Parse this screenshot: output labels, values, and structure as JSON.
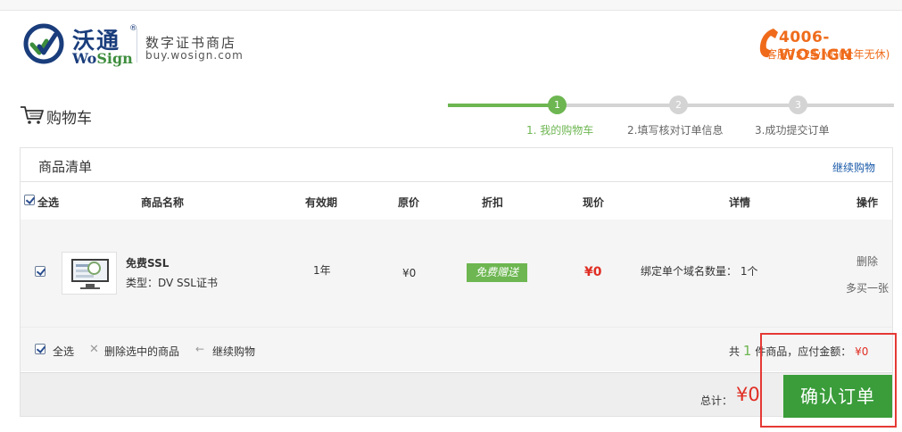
{
  "brand": {
    "name_cn": "沃通",
    "registered_mark": "®",
    "name_en_a": "Wo",
    "name_en_b": "Sign",
    "store_name": "数字证书商店",
    "store_url": "buy.wosign.com",
    "hotline": "4006-WOSIGN",
    "service_hours": "客服7×24小时(全年无休)",
    "accent": "#ef6b1b",
    "navy": "#1a3d7c"
  },
  "page": {
    "title": "购物车"
  },
  "steps": [
    {
      "num": "1",
      "label": "1. 我的购物车",
      "state": "active"
    },
    {
      "num": "2",
      "label": "2.填写核对订单信息",
      "state": "idle"
    },
    {
      "num": "3",
      "label": "3.成功提交订单",
      "state": "idle"
    }
  ],
  "panel": {
    "title": "商品清单",
    "continue_link": "继续购物"
  },
  "columns": {
    "select_all": "全选",
    "name": "商品名称",
    "validity": "有效期",
    "original": "原价",
    "discount": "折扣",
    "current": "现价",
    "details": "详情",
    "actions": "操作"
  },
  "items": [
    {
      "checked": true,
      "name": "免费SSL",
      "type": "类型：DV SSL证书",
      "validity": "1年",
      "original_price": "¥0",
      "discount_badge": "免费赠送",
      "current_price": "¥0",
      "details": "绑定单个域名数量：  1个",
      "action_delete": "删除",
      "action_buy_more": "多买一张"
    }
  ],
  "footer": {
    "select_all": "全选",
    "delete_selected": "删除选中的商品",
    "continue": "继续购物",
    "count_prefix": "共",
    "count": "1",
    "count_suffix": "件商品，应付金额：",
    "amount": "¥0"
  },
  "total": {
    "label": "总计：",
    "value": "¥0",
    "confirm": "确认订单"
  },
  "colors": {
    "green": "#6db651",
    "button_green": "#3a9d3a",
    "price_red": "#e02e24",
    "link_blue": "#1a5aa8"
  }
}
